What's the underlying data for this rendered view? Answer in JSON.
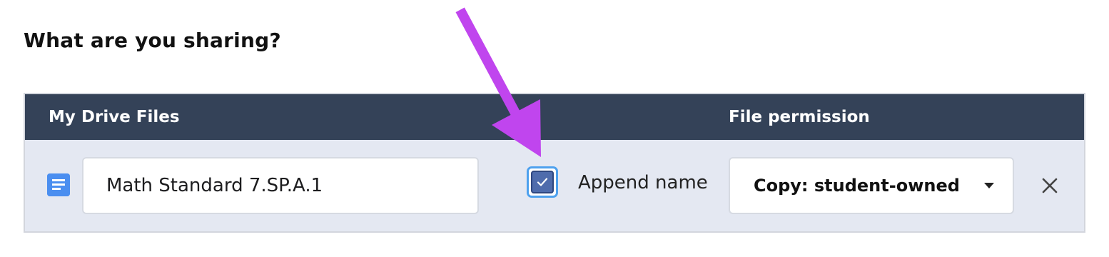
{
  "section": {
    "title": "What are you sharing?"
  },
  "table": {
    "headers": {
      "files": "My Drive Files",
      "permission": "File permission"
    },
    "row": {
      "file_icon": "google-doc-icon",
      "file_name": "Math Standard 7.SP.A.1",
      "append_name": {
        "label": "Append name",
        "checked": true
      },
      "permission": {
        "selected": "Copy: student-owned"
      },
      "remove_icon": "close-icon"
    }
  },
  "annotation": {
    "icon": "arrow-pointer-icon",
    "color": "#c045ee"
  },
  "colors": {
    "header_bg": "#344258",
    "row_bg": "#e4e8f2",
    "checkbox_fill": "#4f6cac",
    "checkbox_focus": "#4ea1ee",
    "doc_icon": "#4a8ef0"
  }
}
